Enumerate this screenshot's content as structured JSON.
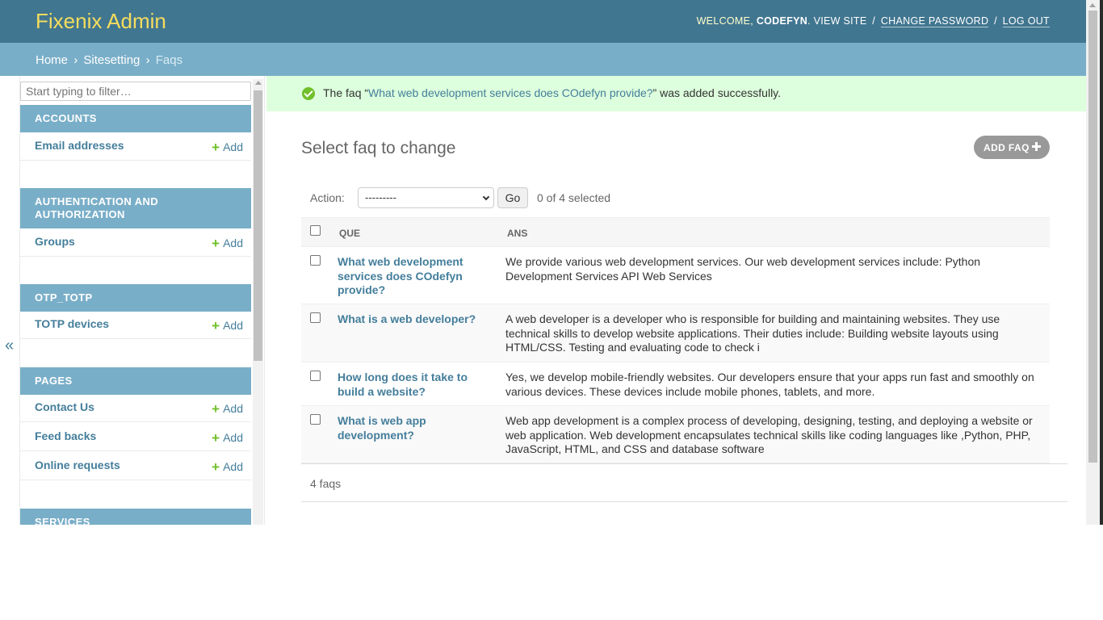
{
  "header": {
    "brand": "Fixenix Admin",
    "welcome": "Welcome,",
    "user": "CODEFYN",
    "view_site": "View site",
    "change_password": "Change password",
    "log_out": "Log out",
    "sep": "/",
    "colors": {
      "header_bg": "#417690",
      "brand": "#f5dd5d",
      "breadcrumb_bg": "#79aec8"
    }
  },
  "breadcrumbs": {
    "home": "Home",
    "sitesetting": "Sitesetting",
    "current": "Faqs",
    "sep": "›"
  },
  "sidebar": {
    "filter_placeholder": "Start typing to filter…",
    "collapse_icon": "«",
    "add_label": "Add",
    "modules": [
      {
        "caption": "Accounts",
        "items": [
          "Email addresses"
        ]
      },
      {
        "caption": "Authentication and Authorization",
        "items": [
          "Groups"
        ]
      },
      {
        "caption": "OTP_TOTP",
        "items": [
          "TOTP devices"
        ]
      },
      {
        "caption": "Pages",
        "items": [
          "Contact Us",
          "Feed backs",
          "Online requests"
        ]
      },
      {
        "caption": "Services",
        "items": []
      }
    ]
  },
  "message": {
    "prefix": "The faq “",
    "link": "What web development services does COdefyn provide?",
    "suffix": "” was added successfully.",
    "icon": "success-check-icon"
  },
  "main": {
    "title": "Select faq to change",
    "add_button": "Add faq",
    "action_label": "Action:",
    "action_selected": "---------",
    "go_label": "Go",
    "counter": "0 of 4 selected",
    "columns": [
      "Que",
      "Ans"
    ],
    "rows": [
      {
        "que": "What web development services does COdefyn provide?",
        "ans": "We provide various web development services. Our web development services include: Python Development Services API Web Services"
      },
      {
        "que": "What is a web developer?",
        "ans": "A web developer is a developer who is responsible for building and maintaining websites. They use technical skills to develop website applications. Their duties include: Building website layouts using HTML/CSS. Testing and evaluating code to check i"
      },
      {
        "que": "How long does it take to build a website?",
        "ans": "Yes, we develop mobile-friendly websites. Our developers ensure that your apps run fast and smoothly on various devices. These devices include mobile phones, tablets, and more."
      },
      {
        "que": "What is web app development?",
        "ans": "Web app development is a complex process of developing, designing, testing, and deploying a website or web application. Web development encapsulates technical skills like coding languages like ,Python, PHP, JavaScript, HTML, and CSS and database software"
      }
    ],
    "paginator": "4 faqs"
  }
}
